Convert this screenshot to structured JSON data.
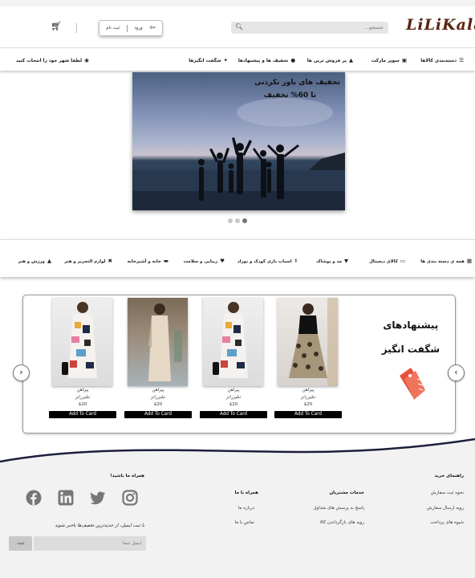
{
  "header": {
    "logo": "LiLiKala",
    "search_placeholder": "جستجو...",
    "login_label": "ورود",
    "signup_label": "ثبت نام"
  },
  "nav": {
    "items": [
      {
        "label": "دسته‌بندی کالاها",
        "icon": "menu-icon"
      },
      {
        "label": "سوپر مارکت",
        "icon": "basket-icon"
      },
      {
        "label": "پر فروش ترین ها",
        "icon": "fire-icon"
      },
      {
        "label": "تخفیف ها و پیشنهادها",
        "icon": "percent-icon"
      },
      {
        "label": "شگفت انگیزها",
        "icon": "stars-icon"
      }
    ],
    "city": "لطفا شهر خود را انتخاب کنید"
  },
  "banner": {
    "line1": "تخفیف های باور نکردنی",
    "line2": "تا 60% تخفیف",
    "active_slide": 3,
    "slides": 3
  },
  "categories": [
    {
      "label": "همه ی دسته بندی ها",
      "icon": "grid-icon"
    },
    {
      "label": "کالای دیجیتال",
      "icon": "laptop-icon"
    },
    {
      "label": "مد و پوشاک",
      "icon": "shirt-icon"
    },
    {
      "label": "اسباب بازی کودک و نوزاد",
      "icon": "baby-icon"
    },
    {
      "label": "زیبایی و سلامت",
      "icon": "heart-icon"
    },
    {
      "label": "خانه و آشپزخانه",
      "icon": "sofa-icon"
    },
    {
      "label": "لوازم التحریر و هنر",
      "icon": "pencil-icon"
    },
    {
      "label": "ورزش و هنر",
      "icon": "dumbbell-icon"
    }
  ],
  "offers": {
    "title_line1": "پیشنهادهای",
    "title_line2": "شگفت انگیز",
    "products": [
      {
        "name": "پیراهن",
        "brand": "تنلیزرانز",
        "price": "$20",
        "button": "Add To Card"
      },
      {
        "name": "پیراهن",
        "brand": "تنلیزرانز",
        "price": "$20",
        "button": "Add To Card"
      },
      {
        "name": "پیراهن",
        "brand": "تنلیزرانز",
        "price": "$20",
        "button": "Add To Card"
      },
      {
        "name": "پیراهن",
        "brand": "تنلیزرانز",
        "price": "$20",
        "button": "Add To Card"
      }
    ]
  },
  "footer": {
    "guide": {
      "title": "راهنمای خرید",
      "links": [
        "نحوه ثبت سفارش",
        "رویه ارسال سفارش",
        "شیوه های پرداخت"
      ]
    },
    "services": {
      "title": "خدمات مشتریان",
      "links": [
        "پاسخ به پرسش های متداول",
        "رویه های بازگرداندن کالا"
      ]
    },
    "about": {
      "title": "همراه با ما",
      "links": [
        "درباره ما",
        "تماس با ما"
      ]
    },
    "follow_title": "همراه ما باشید!",
    "subscribe_text": "با ثبت ایمیل، از جدیدترین تخفیف‌ها باخبر شوید",
    "email_placeholder": "ایمیل شما",
    "submit_label": "ثبت"
  }
}
